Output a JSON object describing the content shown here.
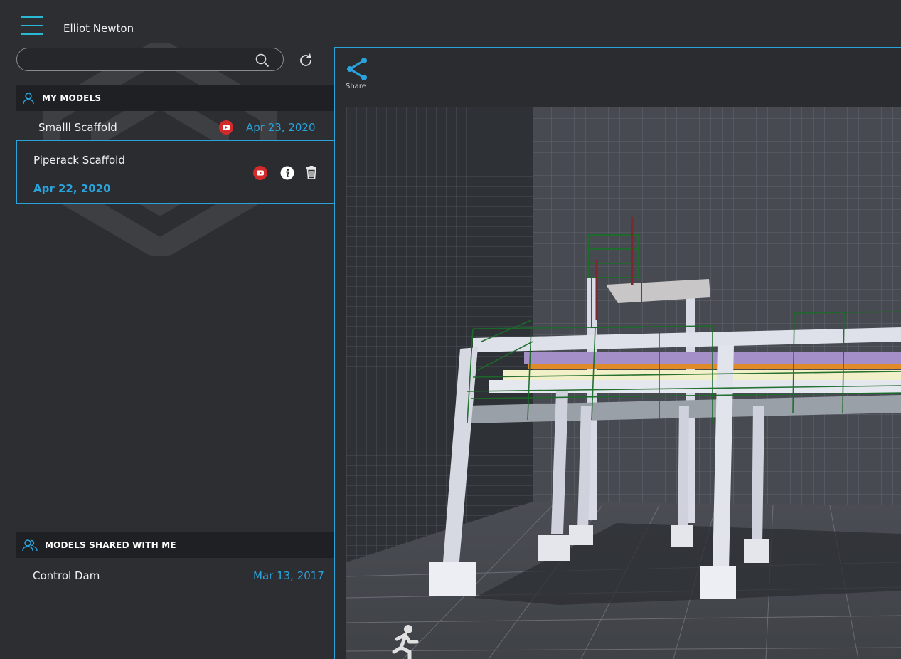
{
  "header": {
    "user_name": "Elliot Newton"
  },
  "search": {
    "placeholder": "",
    "value": ""
  },
  "my_models": {
    "title": "MY MODELS",
    "items": [
      {
        "name": "Smalll Scaffold",
        "date": "Apr 23, 2020"
      },
      {
        "name": "Piperack Scaffold",
        "date": "Apr 22, 2020",
        "selected": true
      }
    ]
  },
  "shared_models": {
    "title": "MODELS SHARED WITH ME",
    "items": [
      {
        "name": "Control Dam",
        "date": "Mar 13, 2017"
      }
    ]
  },
  "viewer": {
    "share_label": "Share"
  },
  "colors": {
    "accent": "#2aa3dc",
    "hamburger": "#29b9d4",
    "youtube": "#d22a2a",
    "background": "#2d2e32"
  },
  "icons": [
    "menu-icon",
    "search-icon",
    "refresh-icon",
    "user-icon",
    "youtube-icon",
    "info-icon",
    "trash-icon",
    "users-icon",
    "share-icon",
    "walk-icon"
  ]
}
